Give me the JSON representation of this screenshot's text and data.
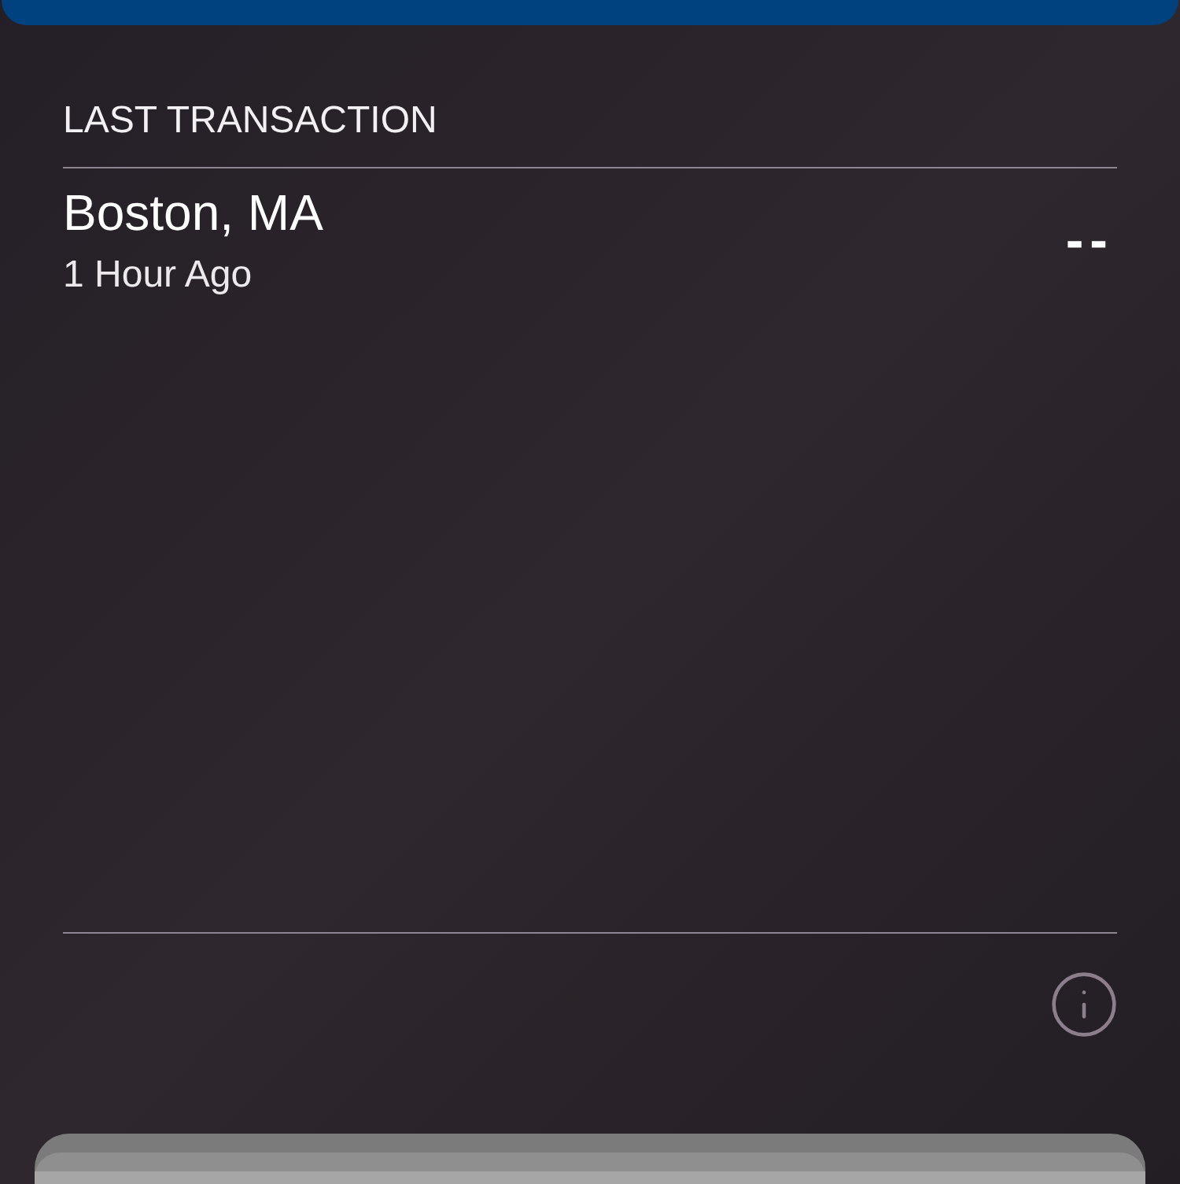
{
  "section": {
    "title": "LAST TRANSACTION"
  },
  "transaction": {
    "location": "Boston, MA",
    "time": "1 Hour Ago",
    "amount": "--"
  }
}
